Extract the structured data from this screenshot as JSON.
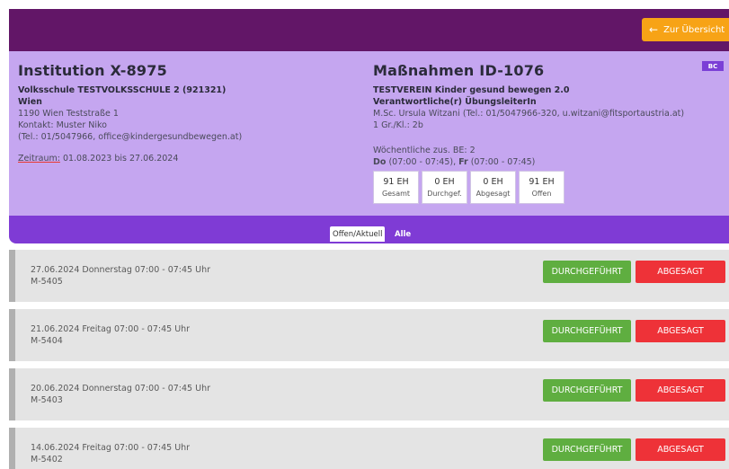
{
  "header": {
    "back_button_label": "Zur Übersicht",
    "back_icon": "arrow-left-icon"
  },
  "institution": {
    "title": "Institution X-8975",
    "school": "Volksschule TESTVOLKSSCHULE 2 (921321)",
    "city": "Wien",
    "address": "1190 Wien Teststraße 1",
    "contact": "Kontakt: Muster Niko",
    "phone_email": "(Tel.: 01/5047966, office@kindergesundbewegen.at)",
    "zeitraum_label": "Zeitraum:",
    "zeitraum_value": " 01.08.2023 bis 27.06.2024"
  },
  "measure": {
    "title": "Maßnahmen ID-1076",
    "badge": "BC",
    "name": "TESTVEREIN Kinder gesund bewegen 2.0",
    "responsible_label": "Verantwortliche(r) ÜbungsleiterIn",
    "responsible_value": "M.Sc. Ursula Witzani (Tel.: 01/5047966-320, u.witzani@fitsportaustria.at)",
    "groups": "1 Gr./Kl.: 2b",
    "weekly": "Wöchentliche zus. BE: 2",
    "schedule_do": "Do",
    "schedule_do_time": " (07:00 - 07:45), ",
    "schedule_fr": "Fr",
    "schedule_fr_time": " (07:00 - 07:45)",
    "stats": [
      {
        "value": "91 EH",
        "label": "Gesamt"
      },
      {
        "value": "0 EH",
        "label": "Durchgef."
      },
      {
        "value": "0 EH",
        "label": "Abgesagt"
      },
      {
        "value": "91 EH",
        "label": "Offen"
      }
    ]
  },
  "tabs": {
    "active": "Offen/Aktuell",
    "all": "Alle"
  },
  "buttons": {
    "done": "DURCHGEFÜHRT",
    "cancel": "ABGESAGT"
  },
  "appointments": [
    {
      "date": "27.06.2024 Donnerstag 07:00 - 07:45 Uhr",
      "code": "M-5405"
    },
    {
      "date": "21.06.2024 Freitag 07:00 - 07:45 Uhr",
      "code": "M-5404"
    },
    {
      "date": "20.06.2024 Donnerstag 07:00 - 07:45 Uhr",
      "code": "M-5403"
    },
    {
      "date": "14.06.2024 Freitag 07:00 - 07:45 Uhr",
      "code": "M-5402"
    }
  ],
  "colors": {
    "topbar": "#621667",
    "info_bg": "#c5a6f0",
    "tabbar": "#7f3bd5",
    "back_button": "#f7a316",
    "done_button": "#5fae40",
    "cancel_button": "#ee3238"
  }
}
